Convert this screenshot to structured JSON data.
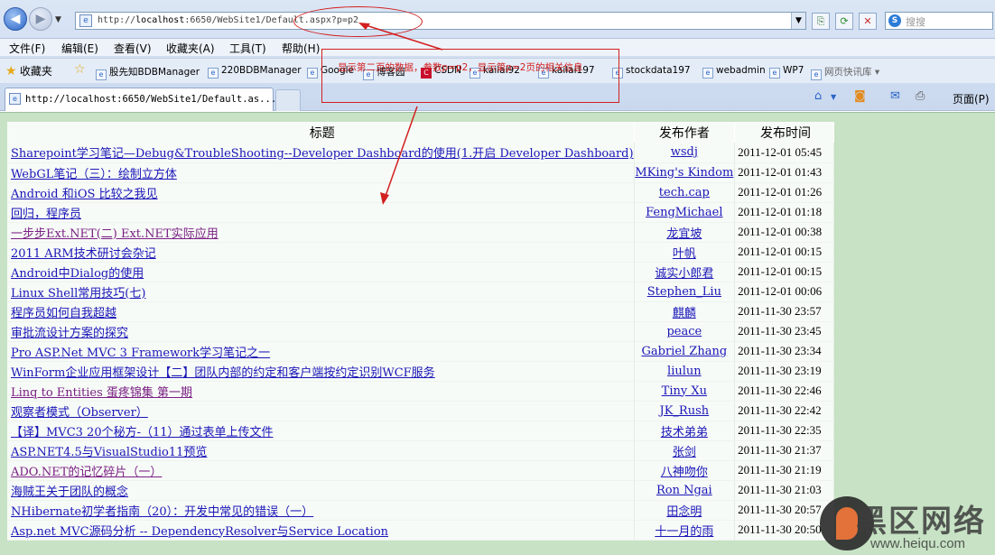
{
  "browser": {
    "address_url_plain": "http://",
    "address_url_host": "localhost",
    "address_url_rest": ":6650/WebSite1/Default.aspx?p=p2",
    "search_placeholder": "搜搜",
    "menu": [
      "文件(F)",
      "编辑(E)",
      "查看(V)",
      "收藏夹(A)",
      "工具(T)",
      "帮助(H)"
    ],
    "favorites_label": "收藏夹",
    "favorites": [
      "股先知BDBManager",
      "220BDBManager",
      "Google",
      "博客园",
      "CSDN",
      "kailai92",
      "kailai197",
      "stockdata197",
      "webadmin",
      "WP7",
      "网页快讯库"
    ],
    "tab_title": "http://localhost:6650/WebSite1/Default.as...",
    "page_menu_label": "页面(P)"
  },
  "annotation": {
    "note": "显示第二页的数据，参数p=p2，显示第p=2页的相关信息"
  },
  "table": {
    "headers": {
      "title": "标题",
      "author": "发布作者",
      "date": "发布时间"
    },
    "rows": [
      {
        "title": "Sharepoint学习笔记—Debug&TroubleShooting--Developer Dashboard的使用(1.开启 Developer Dashboard)",
        "author": "wsdj",
        "date": "2011-12-01 05:45"
      },
      {
        "title": "WebGL笔记（三）：绘制立方体",
        "author": "MKing's Kindom",
        "date": "2011-12-01 01:43"
      },
      {
        "title": "Android 和iOS 比较之我见",
        "author": "tech.cap",
        "date": "2011-12-01 01:26"
      },
      {
        "title": "回归，程序员",
        "author": "FengMichael",
        "date": "2011-12-01 01:18"
      },
      {
        "title": "一步步Ext.NET(二) Ext.NET实际应用",
        "author": "龙宜坡",
        "date": "2011-12-01 00:38"
      },
      {
        "title": "2011 ARM技术研讨会杂记",
        "author": "叶帆",
        "date": "2011-12-01 00:15"
      },
      {
        "title": "Android中Dialog的使用",
        "author": "诚实小郎君",
        "date": "2011-12-01 00:15"
      },
      {
        "title": "Linux Shell常用技巧(七)",
        "author": "Stephen_Liu",
        "date": "2011-12-01 00:06"
      },
      {
        "title": "程序员如何自我超越",
        "author": "麒麟",
        "date": "2011-11-30 23:57"
      },
      {
        "title": "审批流设计方案的探究",
        "author": "peace",
        "date": "2011-11-30 23:45"
      },
      {
        "title": "Pro ASP.Net MVC 3 Framework学习笔记之一",
        "author": "Gabriel Zhang",
        "date": "2011-11-30 23:34"
      },
      {
        "title": "WinForm企业应用框架设计【二】团队内部的约定和客户端按约定识别WCF服务",
        "author": "liulun",
        "date": "2011-11-30 23:19"
      },
      {
        "title": "Linq to Entities 蛋疼锦集 第一期",
        "author": "Tiny Xu",
        "date": "2011-11-30 22:46"
      },
      {
        "title": "观察者模式（Observer）",
        "author": "JK_Rush",
        "date": "2011-11-30 22:42"
      },
      {
        "title": "【译】MVC3 20个秘方-（11）通过表单上传文件",
        "author": "技术弟弟",
        "date": "2011-11-30 22:35"
      },
      {
        "title": "ASP.NET4.5与VisualStudio11预览",
        "author": "张剑",
        "date": "2011-11-30 21:37"
      },
      {
        "title": "ADO.NET的记忆碎片（一）",
        "author": "八神吻你",
        "date": "2011-11-30 21:19"
      },
      {
        "title": "海贼王关于团队的概念",
        "author": "Ron Ngai",
        "date": "2011-11-30 21:03"
      },
      {
        "title": "NHibernate初学者指南（20）：开发中常见的错误（一）",
        "author": "田念明",
        "date": "2011-11-30 20:57"
      },
      {
        "title": "Asp.net MVC源码分析 -- DependencyResolver与Service Location",
        "author": "十一月的雨",
        "date": "2011-11-30 20:50"
      }
    ]
  },
  "watermark": {
    "name": "黑区网络",
    "domain": "www.heiqu.com"
  },
  "colors": {
    "link": "#1a16b8",
    "visited_link": "#7a1f84",
    "annotation": "#d21f1f",
    "page_bg": "#c7e2c4"
  }
}
